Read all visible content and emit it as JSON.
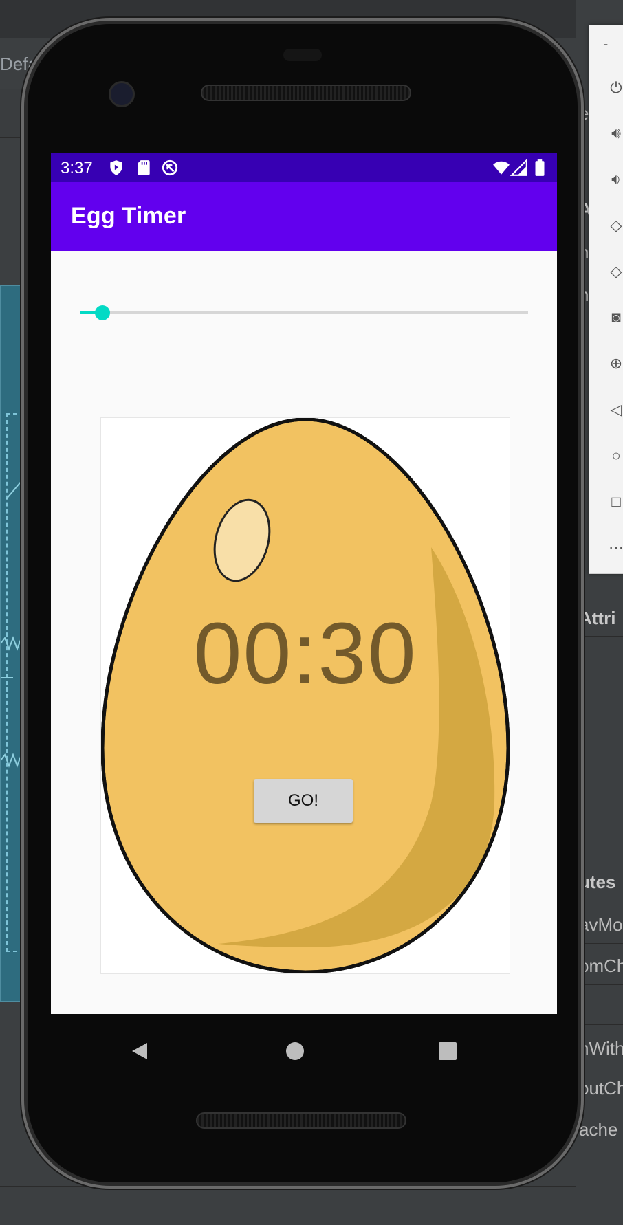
{
  "ide": {
    "tab_fragment": "Defa",
    "right_fragments": [
      "e",
      "A",
      "n",
      "nt",
      "t",
      "Attri",
      "utes",
      "avMo",
      "omCh",
      "nWith",
      "outCh",
      "ache"
    ]
  },
  "status_bar": {
    "time": "3:37",
    "icons": [
      "shield-play-icon",
      "sd-card-icon",
      "do-not-disturb-icon",
      "wifi-icon",
      "signal-icon",
      "battery-icon"
    ]
  },
  "app_bar": {
    "title": "Egg Timer"
  },
  "timer": {
    "slider_fraction": 0.05,
    "time_text": "00:30",
    "go_label": "GO!"
  },
  "emulator_toolbar": {
    "minimize": "-",
    "buttons": [
      "power-icon",
      "volume-up-icon",
      "volume-down-icon",
      "rotate-left-icon",
      "rotate-right-icon",
      "camera-icon",
      "zoom-icon",
      "back-icon",
      "home-icon",
      "overview-icon",
      "more-icon"
    ]
  },
  "colors": {
    "status_bar": "#3700b3",
    "app_bar": "#6200ee",
    "accent": "#03dac5",
    "egg": "#f2c261",
    "timer_text": "#735a2b"
  }
}
